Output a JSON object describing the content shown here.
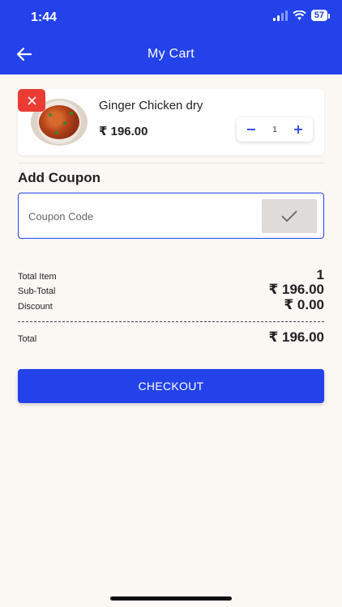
{
  "status_bar": {
    "time": "1:44",
    "battery": "57"
  },
  "header": {
    "title": "My Cart"
  },
  "cart": {
    "items": [
      {
        "name": "Ginger Chicken dry",
        "price": "₹ 196.00",
        "quantity": "1"
      }
    ]
  },
  "coupon": {
    "heading": "Add Coupon",
    "placeholder": "Coupon Code",
    "value": ""
  },
  "summary": {
    "total_item_label": "Total Item",
    "total_item_value": "1",
    "subtotal_label": "Sub-Total",
    "subtotal_value": "₹ 196.00",
    "discount_label": "Discount",
    "discount_value": "₹ 0.00",
    "total_label": "Total",
    "total_value": "₹ 196.00"
  },
  "checkout_label": "CHECKOUT",
  "icons": {
    "back": "arrow-left-icon",
    "remove": "close-icon",
    "minus": "minus-icon",
    "plus": "plus-icon",
    "apply": "check-icon"
  },
  "colors": {
    "primary": "#2342ea",
    "danger": "#ea3c33",
    "background": "#fbf8f4"
  }
}
